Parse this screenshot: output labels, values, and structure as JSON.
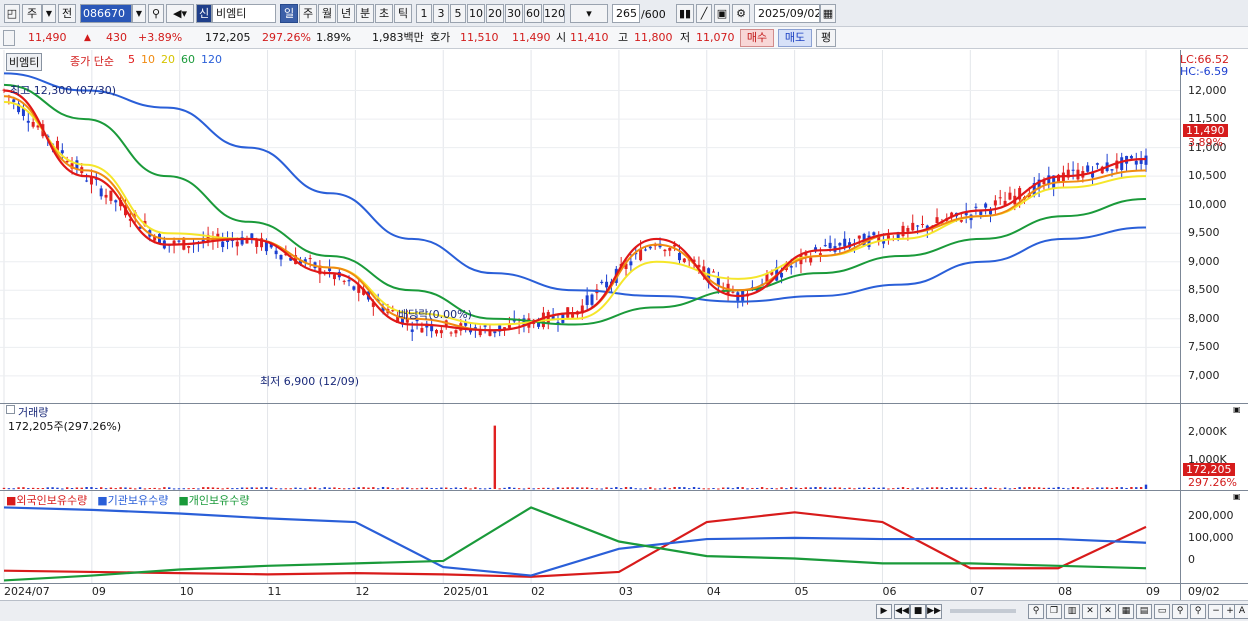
{
  "toolbar": {
    "market_type": "주",
    "all_label": "전",
    "stock_code": "086670",
    "credit_label": "신",
    "stock_name": "비엠티",
    "periods": [
      "일",
      "주",
      "월",
      "년",
      "분",
      "초",
      "틱"
    ],
    "active_period": "일",
    "numbers": [
      "1",
      "3",
      "5",
      "10",
      "20",
      "30",
      "60",
      "120"
    ],
    "count": "265",
    "count_total": "/600",
    "date": "2025/09/02"
  },
  "quote": {
    "price": "11,490",
    "change_arrow": "▲",
    "change": "430",
    "change_pct": "+3.89%",
    "volume": "172,205",
    "volume_ratio": "297.26%",
    "turnover": "1.89%",
    "amount": "1,983백만",
    "bid_label": "호가",
    "ask": "11,510",
    "bid": "11,490",
    "open_label": "시",
    "open": "11,410",
    "high_label": "고",
    "high": "11,800",
    "low_label": "저",
    "low": "11,070",
    "buy_label": "매수",
    "sell_label": "매도",
    "eval_label": "평"
  },
  "price_panel": {
    "name_label": "비엠티",
    "legend_title": "종가 단순",
    "legend_periods": [
      {
        "label": "5",
        "color": "#e01818"
      },
      {
        "label": "10",
        "color": "#f08a10"
      },
      {
        "label": "20",
        "color": "#f5e62a"
      },
      {
        "label": "60",
        "color": "#1a9a3a"
      },
      {
        "label": "120",
        "color": "#2a5fd8"
      }
    ],
    "lc": "LC:66.52",
    "hc": "HC:-6.59",
    "max_label": "최고 12,300 (07/30)",
    "min_label": "최저 6,900 (12/09)",
    "dividend_label": "배당락(0.00%)",
    "price_tag": "11,490",
    "pct_tag": "3.89%",
    "y_ticks": [
      "12,000",
      "11,500",
      "11,000",
      "10,500",
      "10,000",
      "9,500",
      "9,000",
      "8,500",
      "8,000",
      "7,500",
      "7,000"
    ]
  },
  "volume_panel": {
    "title": "거래량",
    "subtitle": "172,205주(297.26%)",
    "y_ticks": [
      "2,000K",
      "1,000K"
    ],
    "vol_tag": "172,205",
    "ratio_tag": "297.26%"
  },
  "holdings_panel": {
    "legend": [
      {
        "label": "외국인보유수량",
        "color": "#d81b1b"
      },
      {
        "label": "기관보유수량",
        "color": "#2a5fd8"
      },
      {
        "label": "개인보유수량",
        "color": "#1a9a3a"
      }
    ],
    "y_ticks": [
      "200,000",
      "100,000",
      "0"
    ]
  },
  "x_axis": [
    "2024/07",
    "09",
    "10",
    "11",
    "12",
    "2025/01",
    "02",
    "03",
    "04",
    "05",
    "06",
    "07",
    "08",
    "09",
    "09/02"
  ],
  "chart_data": {
    "type": "line",
    "title": "",
    "xlabel": "",
    "ylabel": "",
    "ylim": [
      6700,
      12500
    ],
    "series": [
      {
        "name": "5",
        "color": "#e01818",
        "x": [
          "2024/07",
          "08",
          "09",
          "10",
          "11",
          "12",
          "2025/01",
          "02",
          "03",
          "04",
          "05",
          "06",
          "07",
          "08",
          "09"
        ],
        "values": [
          12000,
          10500,
          9300,
          9400,
          8800,
          7900,
          7800,
          8100,
          9400,
          8400,
          9200,
          9500,
          9900,
          10500,
          10800
        ]
      },
      {
        "name": "10",
        "color": "#f08a10",
        "x": [
          "2024/07",
          "08",
          "09",
          "10",
          "11",
          "12",
          "2025/01",
          "02",
          "03",
          "04",
          "05",
          "06",
          "07",
          "08",
          "09"
        ],
        "values": [
          11900,
          10600,
          9400,
          9400,
          8900,
          8000,
          7800,
          8100,
          9300,
          8500,
          9100,
          9500,
          9800,
          10400,
          10600
        ]
      },
      {
        "name": "20",
        "color": "#f5e62a",
        "x": [
          "2024/07",
          "08",
          "09",
          "10",
          "11",
          "12",
          "2025/01",
          "02",
          "03",
          "04",
          "05",
          "06",
          "07",
          "08",
          "09"
        ],
        "values": [
          11800,
          10700,
          9500,
          9400,
          8900,
          8100,
          7900,
          8000,
          9000,
          8700,
          9100,
          9400,
          9800,
          10300,
          10500
        ]
      },
      {
        "name": "60",
        "color": "#1a9a3a",
        "x": [
          "2024/07",
          "08",
          "09",
          "10",
          "11",
          "12",
          "2025/01",
          "02",
          "03",
          "04",
          "05",
          "06",
          "07",
          "08",
          "09"
        ],
        "values": [
          12100,
          11500,
          10500,
          9700,
          9100,
          8500,
          8000,
          7900,
          8200,
          8500,
          8800,
          9100,
          9400,
          9800,
          10100
        ]
      },
      {
        "name": "120",
        "color": "#2a5fd8",
        "x": [
          "2024/07",
          "08",
          "09",
          "10",
          "11",
          "12",
          "2025/01",
          "02",
          "03",
          "04",
          "05",
          "06",
          "07",
          "08",
          "09"
        ],
        "values": [
          12300,
          12000,
          11700,
          11000,
          10200,
          9400,
          8800,
          8500,
          8400,
          8300,
          8400,
          8600,
          9000,
          9400,
          9600
        ]
      }
    ],
    "volume": {
      "peak_date": "2025/01",
      "peak_value": 2500000
    },
    "holdings": [
      {
        "name": "외국인보유수량",
        "x": [
          "2024/07",
          "09",
          "10",
          "11",
          "12",
          "2025/01",
          "02",
          "03",
          "04",
          "05",
          "06",
          "07",
          "08",
          "09"
        ],
        "values": [
          0,
          -5000,
          -10000,
          -15000,
          -10000,
          -15000,
          -25000,
          -5000,
          200000,
          240000,
          200000,
          10000,
          10000,
          180000
        ]
      },
      {
        "name": "기관보유수량",
        "x": [
          "2024/07",
          "09",
          "10",
          "11",
          "12",
          "2025/01",
          "02",
          "03",
          "04",
          "05",
          "06",
          "07",
          "08",
          "09"
        ],
        "values": [
          260000,
          250000,
          235000,
          215000,
          200000,
          15000,
          -20000,
          90000,
          130000,
          135000,
          130000,
          130000,
          130000,
          115000
        ]
      },
      {
        "name": "개인보유수량",
        "x": [
          "2024/07",
          "09",
          "10",
          "11",
          "12",
          "2025/01",
          "02",
          "03",
          "04",
          "05",
          "06",
          "07",
          "08",
          "09"
        ],
        "values": [
          -40000,
          -20000,
          5000,
          20000,
          30000,
          40000,
          260000,
          120000,
          60000,
          50000,
          30000,
          30000,
          20000,
          10000
        ]
      }
    ]
  }
}
